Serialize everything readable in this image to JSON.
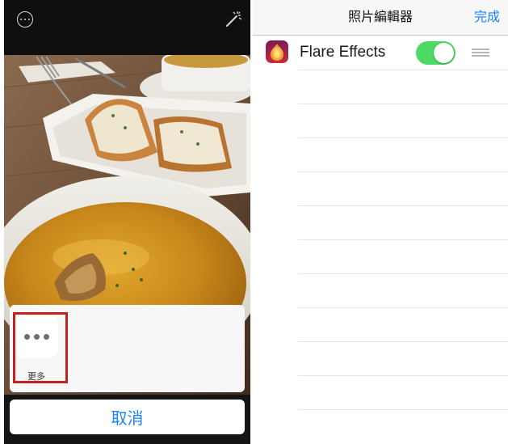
{
  "editor": {
    "more_icon": "more-circle-icon",
    "magic_icon": "magic-wand-icon",
    "share_sheet": {
      "more_action": {
        "icon": "ellipsis-icon",
        "label": "更多"
      }
    },
    "cancel_label": "取消"
  },
  "extensions_panel": {
    "title": "照片編輯器",
    "done_label": "完成",
    "items": [
      {
        "name": "Flare Effects",
        "enabled": true,
        "icon": "flare-effects-app-icon",
        "handle_icon": "reorder-handle-icon"
      }
    ]
  },
  "colors": {
    "accent_blue": "#1a82fb",
    "toggle_on": "#4cd964",
    "highlight_red": "#c0231f"
  }
}
